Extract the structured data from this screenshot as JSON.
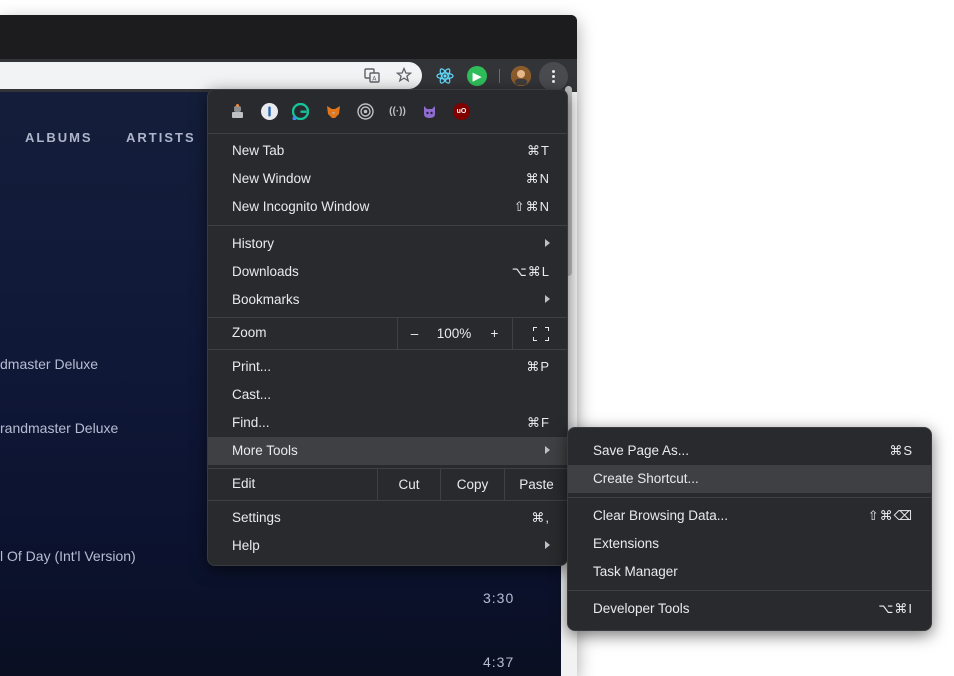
{
  "page": {
    "nav": [
      "ALBUMS",
      "ARTISTS"
    ],
    "tracks": [
      {
        "title": "dmaster Deluxe"
      },
      {
        "title": "randmaster Deluxe"
      },
      {
        "title": "l Of Day (Int'l Version)"
      }
    ],
    "durations": [
      "3:30",
      "4:37"
    ]
  },
  "toolbar": {
    "icons": [
      "translate-icon",
      "bookmark-star-icon",
      "react-devtools-icon",
      "extension-green-icon",
      "profile-avatar-icon",
      "kebab-menu-icon"
    ]
  },
  "menu": {
    "extension_icons": [
      "extension-icon",
      "1password-icon",
      "grammarly-icon",
      "metamask-icon",
      "target-icon",
      "wifi-icon",
      "octocat-icon",
      "ublock-origin-icon"
    ],
    "items": {
      "new_tab": {
        "label": "New Tab",
        "shortcut": "⌘T"
      },
      "new_window": {
        "label": "New Window",
        "shortcut": "⌘N"
      },
      "new_incognito": {
        "label": "New Incognito Window",
        "shortcut": "⇧⌘N"
      },
      "history": {
        "label": "History"
      },
      "downloads": {
        "label": "Downloads",
        "shortcut": "⌥⌘L"
      },
      "bookmarks": {
        "label": "Bookmarks"
      },
      "print": {
        "label": "Print...",
        "shortcut": "⌘P"
      },
      "cast": {
        "label": "Cast..."
      },
      "find": {
        "label": "Find...",
        "shortcut": "⌘F"
      },
      "more_tools": {
        "label": "More Tools"
      },
      "settings": {
        "label": "Settings",
        "shortcut": "⌘,"
      },
      "help": {
        "label": "Help"
      }
    },
    "zoom": {
      "label": "Zoom",
      "minus": "–",
      "value": "100%",
      "plus": "+"
    },
    "edit": {
      "label": "Edit",
      "cut": "Cut",
      "copy": "Copy",
      "paste": "Paste"
    }
  },
  "submenu": {
    "items": {
      "save_page": {
        "label": "Save Page As...",
        "shortcut": "⌘S"
      },
      "create_shortcut": {
        "label": "Create Shortcut..."
      },
      "clear_data": {
        "label": "Clear Browsing Data...",
        "shortcut": "⇧⌘⌫"
      },
      "extensions": {
        "label": "Extensions"
      },
      "task_manager": {
        "label": "Task Manager"
      },
      "dev_tools": {
        "label": "Developer Tools",
        "shortcut": "⌥⌘I"
      }
    }
  },
  "colors": {
    "menu_bg": "#292a2d",
    "highlight": "#3f4043",
    "text": "#e8eaed",
    "page_bg": "#101838"
  }
}
